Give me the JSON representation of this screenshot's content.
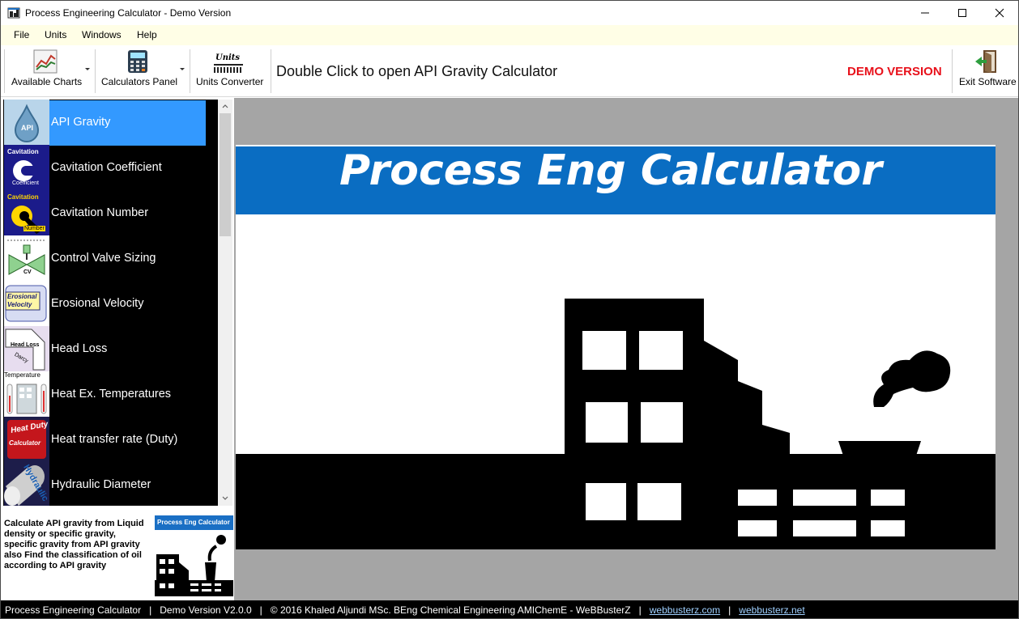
{
  "window": {
    "title": "Process Engineering Calculator - Demo Version"
  },
  "menu": [
    "File",
    "Units",
    "Windows",
    "Help"
  ],
  "toolbar": {
    "available_charts": "Available Charts",
    "calculators_panel": "Calculators Panel",
    "units_converter": "Units Converter",
    "hint": "Double Click to open API Gravity Calculator",
    "demo": "DEMO VERSION",
    "exit": "Exit Software",
    "units_icon_text": "Units"
  },
  "calculators": [
    {
      "label": "API Gravity",
      "selected": true,
      "icon": "api-gravity-icon",
      "icon_text": "API"
    },
    {
      "label": "Cavitation Coefficient",
      "icon": "cavitation-coefficient-icon",
      "icon_text": "Cavitation",
      "icon_sub": "Coefficient"
    },
    {
      "label": "Cavitation Number",
      "icon": "cavitation-number-icon",
      "icon_text": "Cavitation",
      "icon_sub": "Number"
    },
    {
      "label": "Control Valve Sizing",
      "icon": "control-valve-icon",
      "icon_text": "CV"
    },
    {
      "label": "Erosional Velocity",
      "icon": "erosional-velocity-icon",
      "icon_text": "Erosional",
      "icon_sub": "Velocity"
    },
    {
      "label": "Head Loss",
      "icon": "head-loss-icon",
      "icon_text": "Head Loss",
      "icon_sub": "Darcy"
    },
    {
      "label": "Heat Ex. Temperatures",
      "icon": "heat-exchanger-icon",
      "icon_text": "Temperature"
    },
    {
      "label": "Heat transfer rate (Duty)",
      "icon": "heat-duty-icon",
      "icon_text": "Heat Duty",
      "icon_sub": "Calculator"
    },
    {
      "label": "Hydraulic Diameter",
      "icon": "hydraulic-diameter-icon",
      "icon_text": "Hydraulic"
    }
  ],
  "description": "Calculate API gravity from Liquid density or specific gravity, specific gravity from API gravity also Find the classification of oil according to API gravity",
  "mini_logo_title": "Process Eng Calculator",
  "banner_title": "Process Eng Calculator",
  "status": {
    "app": "Process Engineering Calculator",
    "version": "Demo Version V2.0.0",
    "copyright": "© 2016 Khaled Aljundi MSc. BEng Chemical Engineering AMIChemE - WeBBusterZ",
    "link1": "webbusterz.com",
    "link2": "webbusterz.net"
  },
  "colors": {
    "menubar": "#fffee6",
    "selection": "#3399ff",
    "banner_blue": "#0a6dc2",
    "demo_red": "#e8111b"
  }
}
